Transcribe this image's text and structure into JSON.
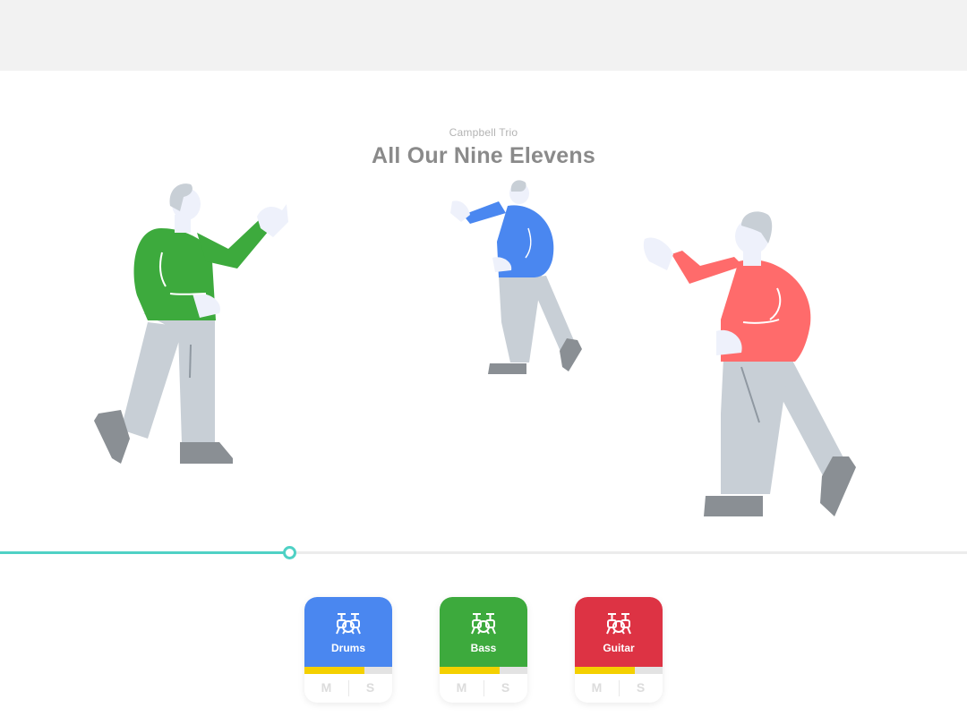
{
  "song": {
    "artist": "Campbell Trio",
    "title": "All Our Nine Elevens"
  },
  "playback": {
    "progress": 0.299
  },
  "tracks": [
    {
      "name": "Drums",
      "color": "#4a87f0",
      "volume": 0.68,
      "icon": "drum-kit-icon",
      "mute_label": "M",
      "solo_label": "S"
    },
    {
      "name": "Bass",
      "color": "#3daa3d",
      "volume": 0.68,
      "icon": "drum-kit-icon",
      "mute_label": "M",
      "solo_label": "S"
    },
    {
      "name": "Guitar",
      "color": "#dd3344",
      "volume": 0.68,
      "icon": "drum-kit-icon",
      "mute_label": "M",
      "solo_label": "S"
    }
  ],
  "colors": {
    "accent": "#4fd1c5",
    "volume": "#f4d000",
    "drums_shirt": "#3daa3d",
    "bass_shirt": "#4a87f0",
    "guitar_shirt": "#ff6b6b"
  }
}
